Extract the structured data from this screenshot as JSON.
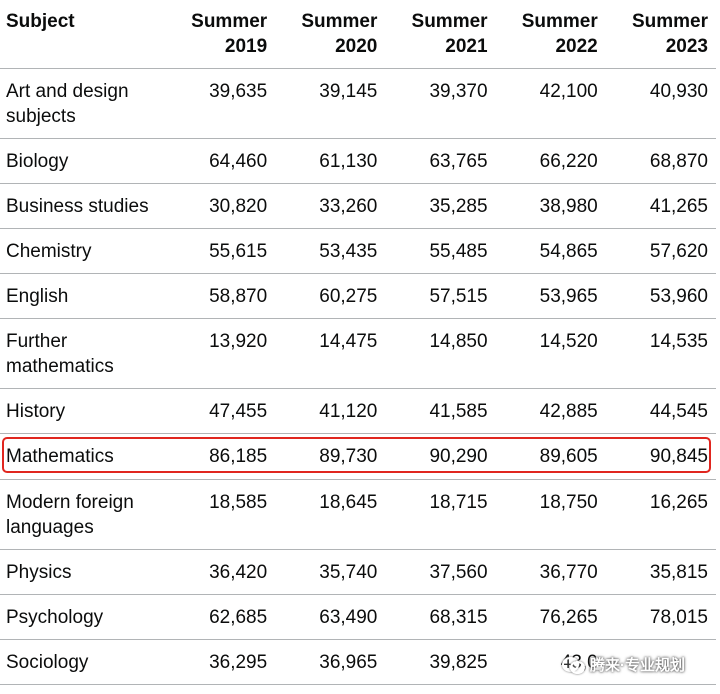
{
  "table": {
    "headers": [
      {
        "line1": "Subject",
        "line2": ""
      },
      {
        "line1": "Summer",
        "line2": "2019"
      },
      {
        "line1": "Summer",
        "line2": "2020"
      },
      {
        "line1": "Summer",
        "line2": "2021"
      },
      {
        "line1": "Summer",
        "line2": "2022"
      },
      {
        "line1": "Summer",
        "line2": "2023"
      }
    ],
    "rows": [
      {
        "subject": "Art and design subjects",
        "values": [
          "39,635",
          "39,145",
          "39,370",
          "42,100",
          "40,930"
        ]
      },
      {
        "subject": "Biology",
        "values": [
          "64,460",
          "61,130",
          "63,765",
          "66,220",
          "68,870"
        ]
      },
      {
        "subject": "Business studies",
        "values": [
          "30,820",
          "33,260",
          "35,285",
          "38,980",
          "41,265"
        ]
      },
      {
        "subject": "Chemistry",
        "values": [
          "55,615",
          "53,435",
          "55,485",
          "54,865",
          "57,620"
        ]
      },
      {
        "subject": "English",
        "values": [
          "58,870",
          "60,275",
          "57,515",
          "53,965",
          "53,960"
        ]
      },
      {
        "subject": "Further mathematics",
        "values": [
          "13,920",
          "14,475",
          "14,850",
          "14,520",
          "14,535"
        ]
      },
      {
        "subject": "History",
        "values": [
          "47,455",
          "41,120",
          "41,585",
          "42,885",
          "44,545"
        ]
      },
      {
        "subject": "Mathematics",
        "values": [
          "86,185",
          "89,730",
          "90,290",
          "89,605",
          "90,845"
        ]
      },
      {
        "subject": "Modern foreign languages",
        "values": [
          "18,585",
          "18,645",
          "18,715",
          "18,750",
          "16,265"
        ]
      },
      {
        "subject": "Physics",
        "values": [
          "36,420",
          "35,740",
          "37,560",
          "36,770",
          "35,815"
        ]
      },
      {
        "subject": "Psychology",
        "values": [
          "62,685",
          "63,490",
          "68,315",
          "76,265",
          "78,015"
        ]
      },
      {
        "subject": "Sociology",
        "values": [
          "36,295",
          "36,965",
          "39,825",
          "43,0",
          ""
        ]
      }
    ]
  },
  "highlight": {
    "row_subject": "Mathematics",
    "color": "#e0261f"
  },
  "watermark": {
    "icon": "chat-bubbles-icon",
    "text": "腾来·专业规划"
  }
}
